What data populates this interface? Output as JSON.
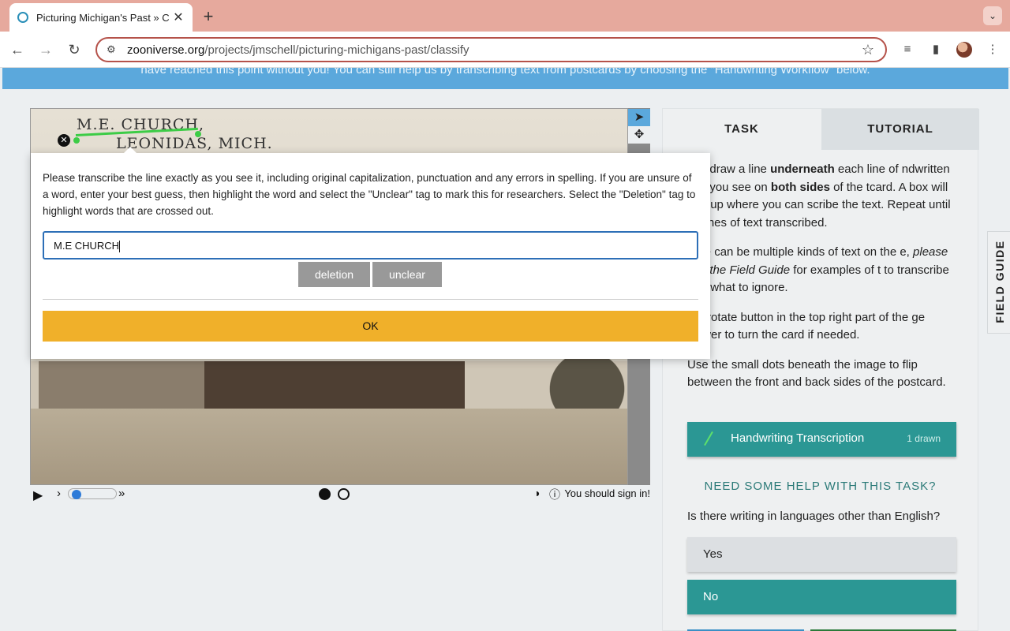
{
  "browser": {
    "tab_title": "Picturing Michigan's Past » C",
    "url_domain": "zooniverse.org",
    "url_path": "/projects/jmschell/picturing-michigans-past/classify"
  },
  "banner": {
    "text": "have reached this point without you! You can still help us by transcribing text from postcards by choosing the \"Handwriting Workflow\" below."
  },
  "subject": {
    "handwriting_line1": "M.E. CHURCH,",
    "handwriting_line2": "LEONIDAS, MICH."
  },
  "controls": {
    "signin_text": "You should sign in!",
    "frames": [
      {
        "active": true
      },
      {
        "active": false
      }
    ]
  },
  "modal": {
    "instructions": "Please transcribe the line exactly as you see it, including original capitalization, punctuation and any errors in spelling. If you are unsure of a word, enter your best guess, then highlight the word and select the \"Unclear\" tag to mark this for researchers. Select the \"Deletion\" tag to highlight words that are crossed out.",
    "input_value": "M.E CHURCH",
    "tag_deletion": "deletion",
    "tag_unclear": "unclear",
    "ok_label": "OK"
  },
  "panel": {
    "tab_task": "TASK",
    "tab_tutorial": "TUTORIAL",
    "instr_p1_a": "ase draw a line ",
    "instr_p1_b": "underneath",
    "instr_p1_c": " each line of ndwritten text you see on ",
    "instr_p1_d": "both sides",
    "instr_p1_e": " of the tcard. A box will pop up where you can scribe the text. Repeat until all lines of text transcribed.",
    "instr_p2_a": "here can be multiple kinds of text on the e, ",
    "instr_p2_b": "please see the Field Guide",
    "instr_p2_c": " for examples of t to transcribe and what to ignore.",
    "instr_p3": " the rotate button in the top right part of the ge viewer to turn the card if needed.",
    "instr_p4": "Use the small dots beneath the image to flip between the front and back sides of the postcard.",
    "task_label": "Handwriting Transcription",
    "task_count": "1 drawn",
    "help_link": "NEED SOME HELP WITH THIS TASK?",
    "question": "Is there writing in languages other than English?",
    "answer_yes": "Yes",
    "answer_no": "No",
    "selected_answer": "No"
  },
  "field_guide": "FIELD GUIDE",
  "colors": {
    "teal": "#2b9794",
    "banner_blue": "#5ba8dc",
    "ok_orange": "#f0b02a",
    "mark_green": "#3ccc46",
    "tab_strip": "#e6a99d"
  }
}
